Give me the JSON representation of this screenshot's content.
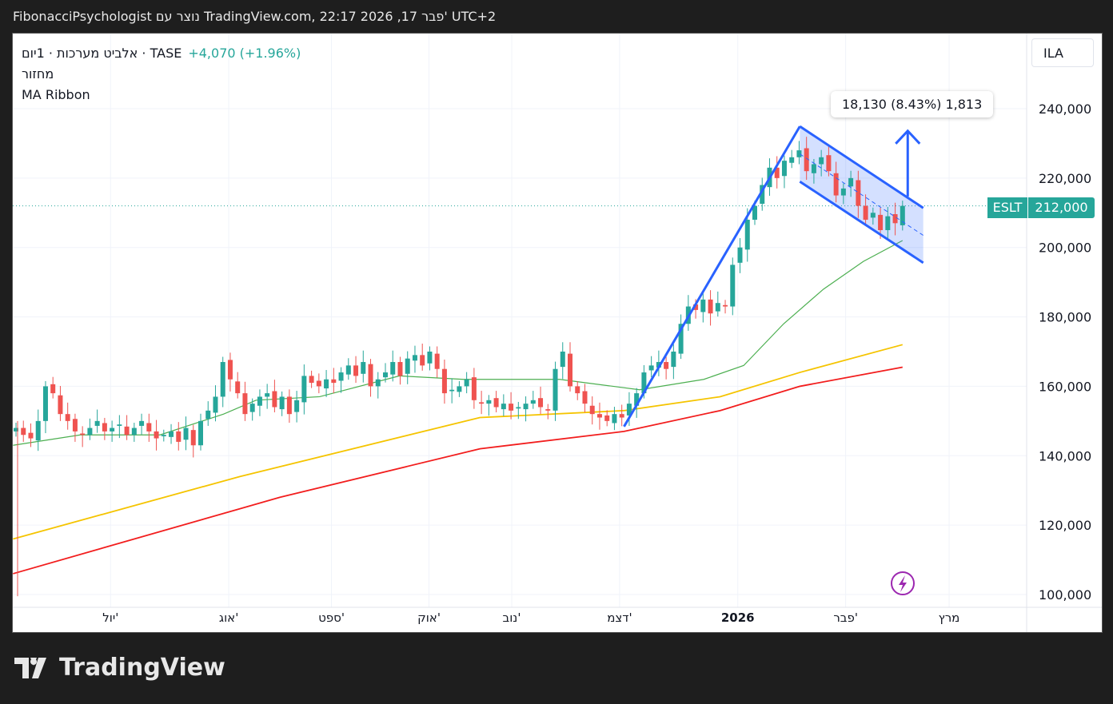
{
  "header": {
    "title": "FibonacciPsychologist נוצר עם TradingView.com, 22:17 2026 ,17 פבר' UTC+2"
  },
  "legend": {
    "symbol": "אלביט מערכות · 1יום · TASE",
    "change": "+4,070 (+1.96%)",
    "volume": "מחזור",
    "indicator": "MA Ribbon"
  },
  "currency": "ILA",
  "measure": {
    "text": "18,130 (8.43%) 1,813"
  },
  "price_badge": {
    "ticker": "ESLT",
    "price": "212,000",
    "value": 212000
  },
  "colors": {
    "up": "#26a69a",
    "down": "#ef5350",
    "drawing": "#2962ff",
    "ma1": "#4caf50",
    "ma2": "#f5c400",
    "ma3": "#f21d1d"
  },
  "footer": {
    "brand": "TradingView"
  },
  "chart_data": {
    "type": "candlestick",
    "y_ticks": [
      "240,000",
      "220,000",
      "200,000",
      "180,000",
      "160,000",
      "140,000",
      "120,000",
      "100,000"
    ],
    "y_tick_values": [
      240000,
      220000,
      200000,
      180000,
      160000,
      140000,
      120000,
      100000
    ],
    "ylim": [
      100000,
      240000
    ],
    "x_ticks": [
      {
        "label": "יול'",
        "i": 12.8
      },
      {
        "label": "אוג'",
        "i": 28.8
      },
      {
        "label": "ספט'",
        "i": 42.7
      },
      {
        "label": "אוק'",
        "i": 55.9
      },
      {
        "label": "נוב'",
        "i": 67.1
      },
      {
        "label": "דצמ'",
        "i": 81.7
      },
      {
        "label": "2026",
        "i": 97.7
      },
      {
        "label": "פבר'",
        "i": 112.3
      },
      {
        "label": "מרץ",
        "i": 126.3
      }
    ],
    "closes_k": [
      148,
      146,
      145,
      150,
      160,
      158,
      152,
      150,
      147,
      146,
      148,
      150,
      147,
      148,
      149,
      146,
      148,
      150,
      147,
      145,
      146,
      147,
      144,
      148,
      143,
      150,
      153,
      157,
      167,
      162,
      158,
      152,
      155,
      157,
      158,
      154,
      157,
      152,
      156,
      163,
      161,
      160,
      162,
      161,
      164,
      166,
      163,
      167,
      160,
      162,
      164,
      167,
      163,
      168,
      169,
      166,
      170,
      165,
      158,
      159,
      160,
      162,
      156,
      155,
      156,
      154,
      155,
      153,
      154,
      155,
      156,
      154,
      153,
      165,
      170,
      160,
      158,
      155,
      152,
      151,
      150,
      152,
      151,
      155,
      158,
      164,
      166,
      167,
      165,
      170,
      178,
      183,
      182,
      185,
      181,
      184,
      183,
      195,
      200,
      208,
      212,
      218,
      223,
      220,
      225,
      226,
      228,
      222,
      224,
      226,
      222,
      215,
      217,
      220,
      212,
      208,
      210,
      205,
      209,
      207,
      212
    ],
    "ma_series": [
      {
        "name": "MA short",
        "color": "#4caf50",
        "points": [
          [
            -0.4,
            143
          ],
          [
            8.7,
            146
          ],
          [
            19.5,
            146
          ],
          [
            28.1,
            152
          ],
          [
            32.5,
            156
          ],
          [
            41.1,
            157
          ],
          [
            51.9,
            163
          ],
          [
            60.6,
            162
          ],
          [
            73.6,
            162
          ],
          [
            84.4,
            159
          ],
          [
            93.1,
            162
          ],
          [
            98.5,
            166
          ],
          [
            103.9,
            178
          ],
          [
            109.3,
            188
          ],
          [
            114.7,
            196
          ],
          [
            120,
            202
          ]
        ]
      },
      {
        "name": "MA mid",
        "color": "#f5c400",
        "points": [
          [
            -0.4,
            116
          ],
          [
            30.3,
            134
          ],
          [
            62.8,
            151
          ],
          [
            82.3,
            153
          ],
          [
            95.3,
            157
          ],
          [
            106.1,
            164
          ],
          [
            120,
            172
          ]
        ]
      },
      {
        "name": "MA long",
        "color": "#f21d1d",
        "points": [
          [
            -0.4,
            106
          ],
          [
            35.7,
            128
          ],
          [
            62.8,
            142
          ],
          [
            82.3,
            147
          ],
          [
            95.3,
            153
          ],
          [
            106.1,
            160
          ],
          [
            120,
            165.5
          ]
        ]
      }
    ],
    "drawings": {
      "trend_line": [
        [
          82.3,
          148.4
        ],
        [
          106.1,
          234.9
        ]
      ],
      "channel_upper": [
        [
          106.1,
          234.9
        ],
        [
          122.8,
          211.4
        ]
      ],
      "channel_lower": [
        [
          106.1,
          219.0
        ],
        [
          122.8,
          195.6
        ]
      ],
      "arrow": [
        [
          120.7,
          214.7
        ],
        [
          120.7,
          233.6
        ]
      ]
    }
  }
}
